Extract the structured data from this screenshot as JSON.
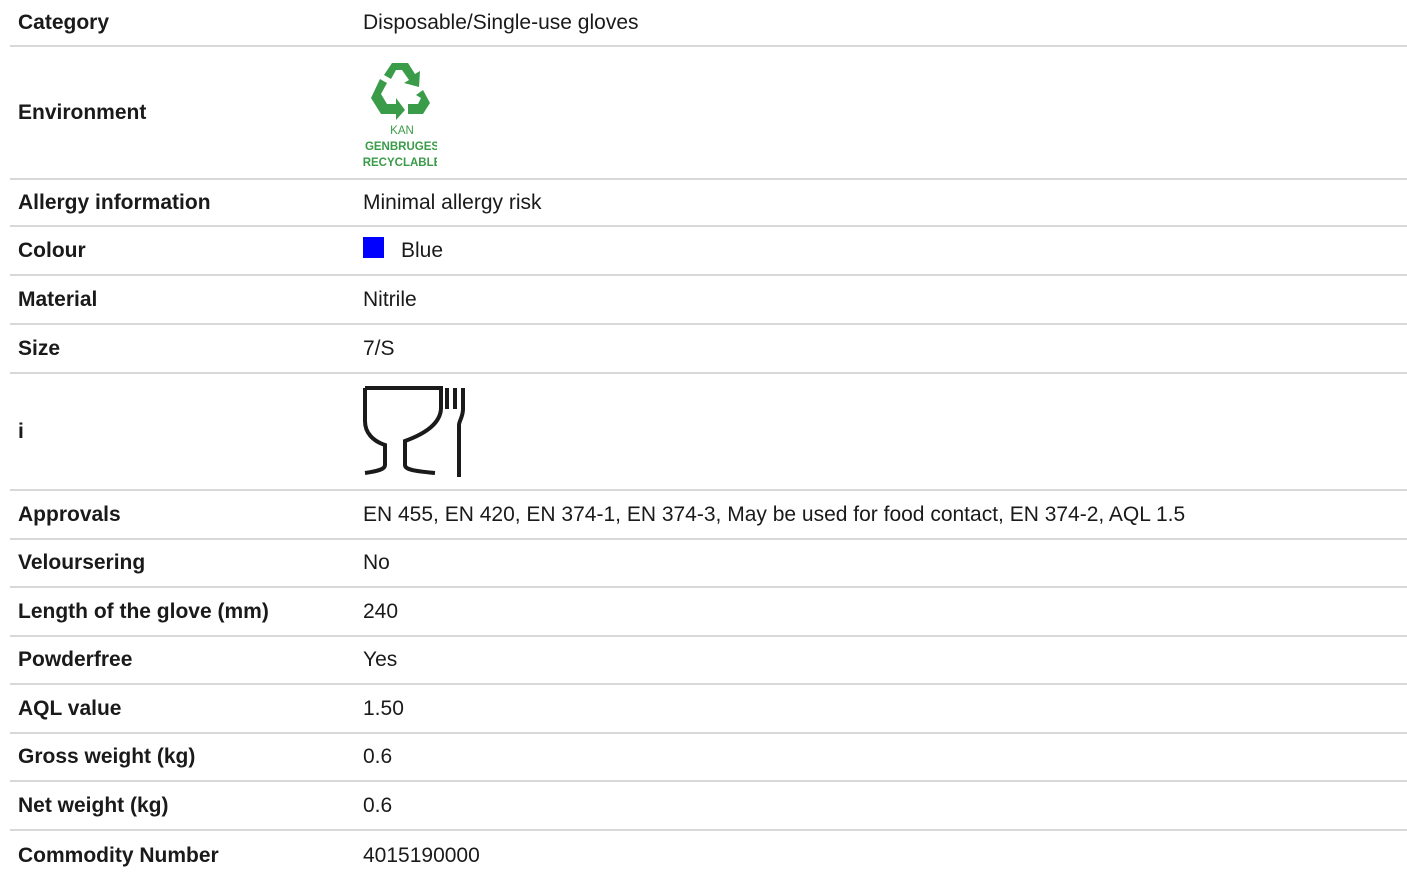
{
  "rows": [
    {
      "label": "Category",
      "value": "Disposable/Single-use gloves"
    },
    {
      "label": "Environment",
      "logo_text": [
        "KAN",
        "GENBRUGES",
        "RECYCLABLE"
      ],
      "logo_icon": "recycle-icon",
      "logo_color": "#3a9b48"
    },
    {
      "label": "Allergy information",
      "value": "Minimal allergy risk"
    },
    {
      "label": "Colour",
      "value": "Blue",
      "swatch_color": "#0000ff"
    },
    {
      "label": "Material",
      "value": "Nitrile"
    },
    {
      "label": "Size",
      "value": "7/S"
    },
    {
      "label": "i",
      "icon": "food-safe-glass-fork-icon"
    },
    {
      "label": "Approvals",
      "value": "EN 455, EN 420, EN 374-1, EN 374-3, May be used for food contact, EN 374-2, AQL 1.5"
    },
    {
      "label": "Veloursering",
      "value": "No"
    },
    {
      "label": "Length of the glove (mm)",
      "value": "240"
    },
    {
      "label": "Powderfree",
      "value": "Yes"
    },
    {
      "label": "AQL value",
      "value": "1.50"
    },
    {
      "label": "Gross weight (kg)",
      "value": "0.6"
    },
    {
      "label": "Net weight (kg)",
      "value": "0.6"
    },
    {
      "label": "Commodity Number",
      "value": "4015190000"
    }
  ]
}
